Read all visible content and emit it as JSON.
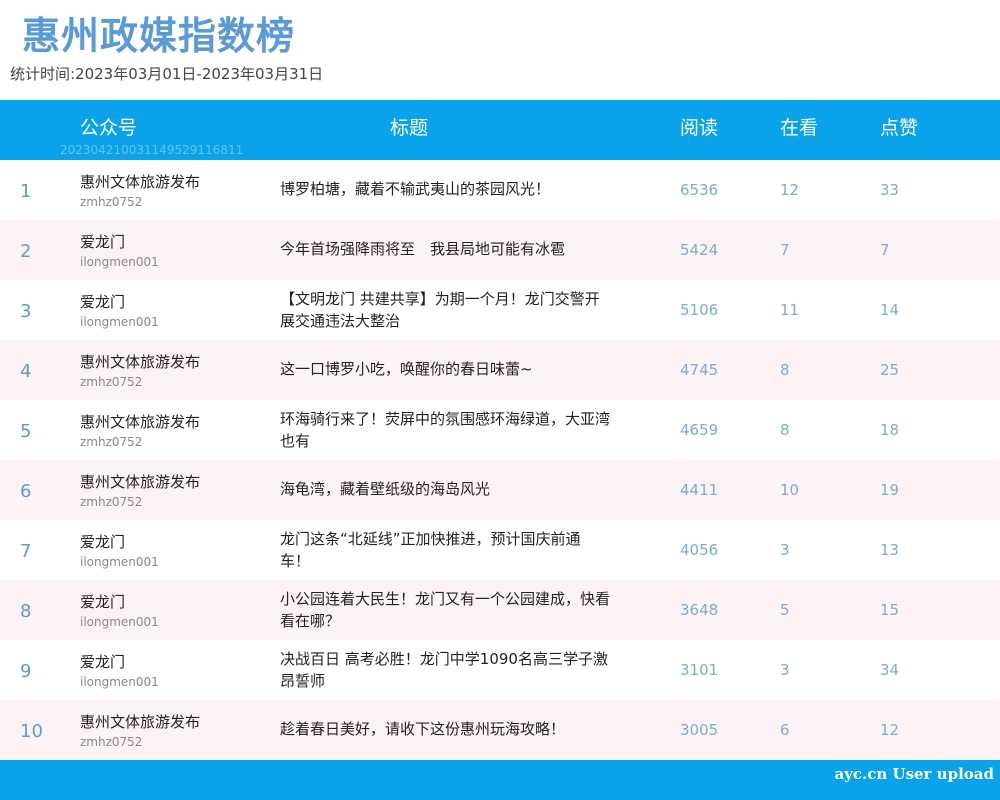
{
  "title": "惠州政媒指数榜",
  "period": "统计时间:2023年03月01日-2023年03月31日",
  "header": {
    "account": "公众号",
    "title": "标题",
    "reads": "阅读",
    "watching": "在看",
    "likes": "点赞",
    "watermark": "20230421003114952911681​1"
  },
  "rows": [
    {
      "rank": "1",
      "account": "惠州文体旅游发布",
      "account_id": "zmhz0752",
      "title": "博罗柏塘，藏着不输武夷山的茶园风光！",
      "reads": "6536",
      "watching": "12",
      "likes": "33"
    },
    {
      "rank": "2",
      "account": "爱龙门",
      "account_id": "ilongmen001",
      "title": "今年首场强降雨将至　我县局地可能有冰雹",
      "reads": "5424",
      "watching": "7",
      "likes": "7"
    },
    {
      "rank": "3",
      "account": "爱龙门",
      "account_id": "ilongmen001",
      "title": "【文明龙门 共建共享】为期一个月！龙门交警开展交通违法大整治",
      "reads": "5106",
      "watching": "11",
      "likes": "14"
    },
    {
      "rank": "4",
      "account": "惠州文体旅游发布",
      "account_id": "zmhz0752",
      "title": "这一口博罗小吃，唤醒你的春日味蕾~",
      "reads": "4745",
      "watching": "8",
      "likes": "25"
    },
    {
      "rank": "5",
      "account": "惠州文体旅游发布",
      "account_id": "zmhz0752",
      "title": "环海骑行来了！荧屏中的氛围感环海绿道，大亚湾也有",
      "reads": "4659",
      "watching": "8",
      "likes": "18"
    },
    {
      "rank": "6",
      "account": "惠州文体旅游发布",
      "account_id": "zmhz0752",
      "title": "海龟湾，藏着壁纸级的海岛风光",
      "reads": "4411",
      "watching": "10",
      "likes": "19"
    },
    {
      "rank": "7",
      "account": "爱龙门",
      "account_id": "ilongmen001",
      "title": "龙门这条“北延线”正加快推进，预计国庆前通车！",
      "reads": "4056",
      "watching": "3",
      "likes": "13"
    },
    {
      "rank": "8",
      "account": "爱龙门",
      "account_id": "ilongmen001",
      "title": "小公园连着大民生！龙门又有一个公园建成，快看看在哪？",
      "reads": "3648",
      "watching": "5",
      "likes": "15"
    },
    {
      "rank": "9",
      "account": "爱龙门",
      "account_id": "ilongmen001",
      "title": "决战百日 高考必胜！龙门中学1090名高三学子激昂誓师",
      "reads": "3101",
      "watching": "3",
      "likes": "34"
    },
    {
      "rank": "10",
      "account": "惠州文体旅游发布",
      "account_id": "zmhz0752",
      "title": "趁着春日美好，请收下这份惠州玩海攻略！",
      "reads": "3005",
      "watching": "6",
      "likes": "12"
    }
  ],
  "footer": {
    "credit": "ayc.cn User upload"
  },
  "colors": {
    "accent": "#0aa3e9",
    "title": "#5a9ad6",
    "stripe": "#fdf3f5",
    "number": "#7aaad6"
  }
}
